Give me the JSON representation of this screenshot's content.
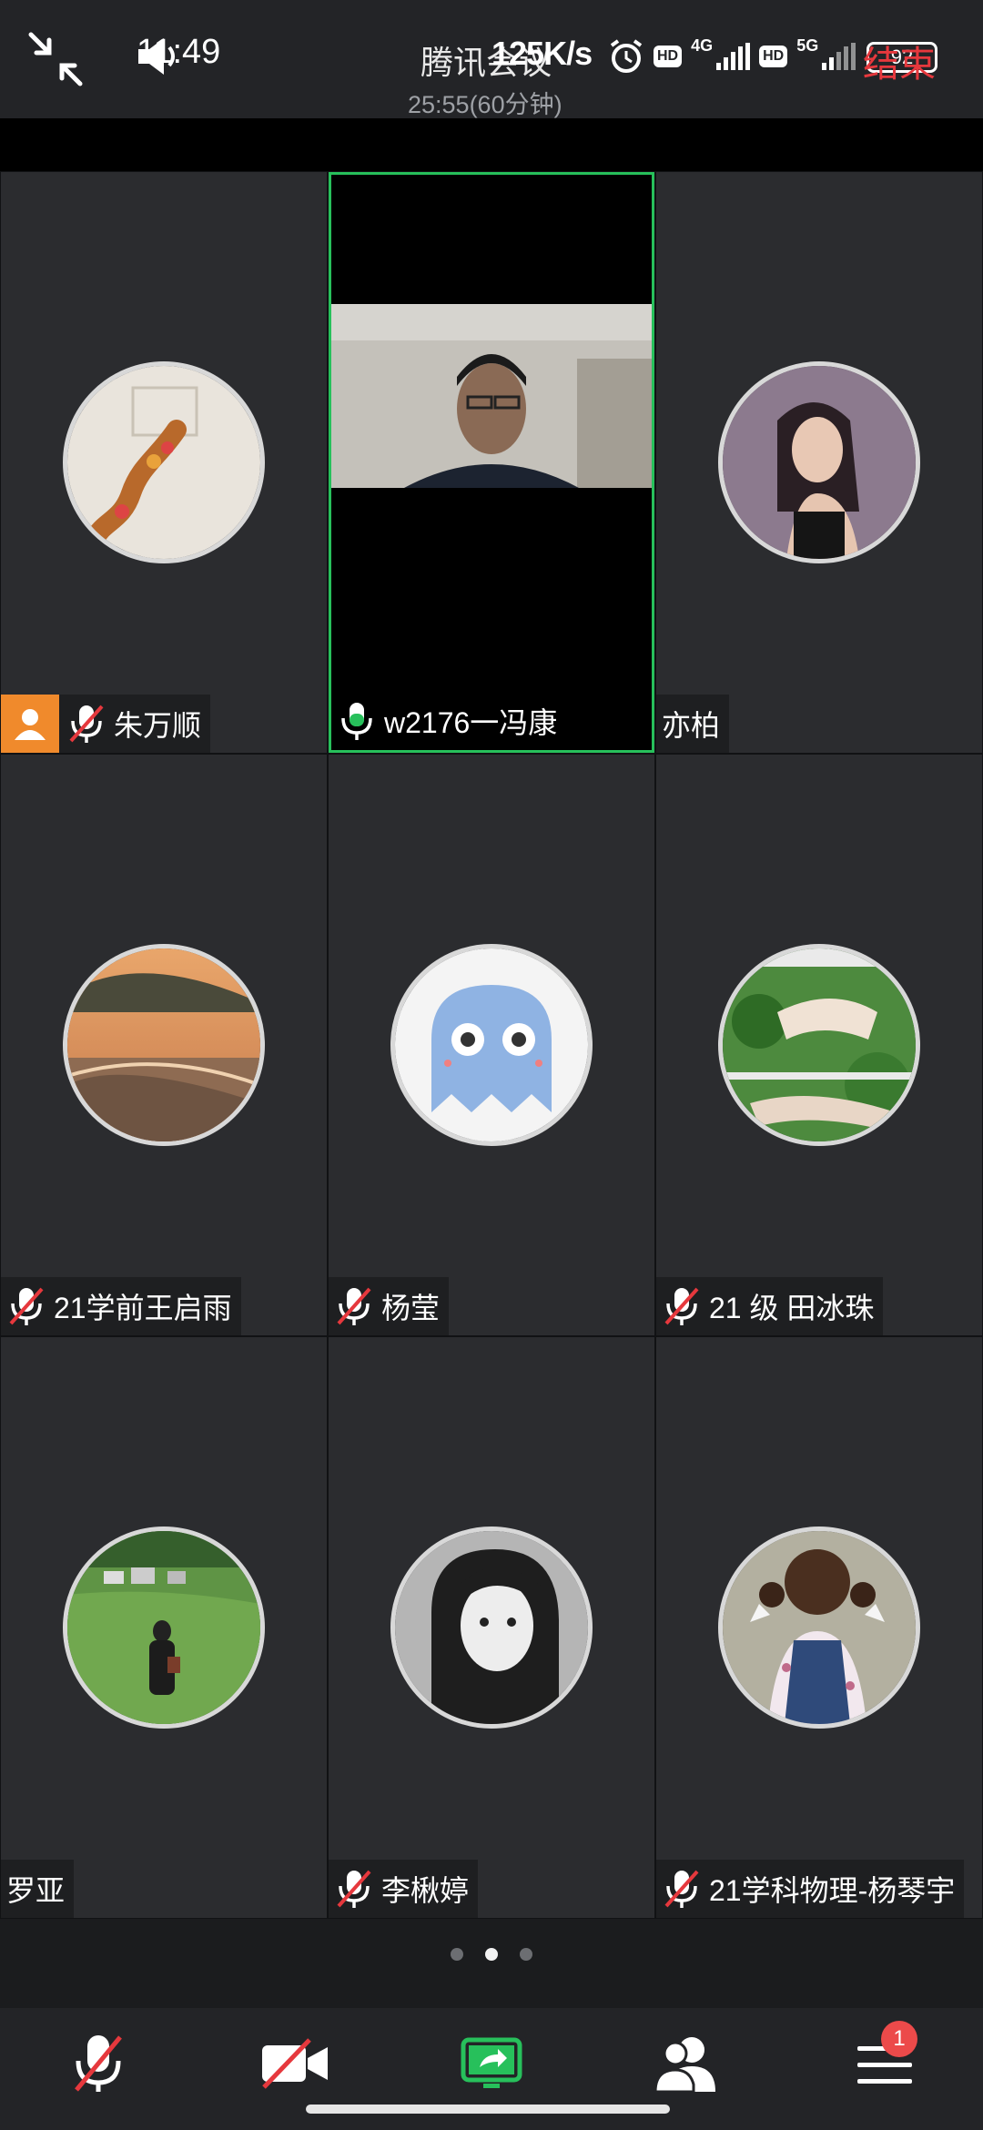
{
  "status_bar": {
    "time": "11:49",
    "net_speed": "125K/s",
    "battery": "92",
    "net_1": "4G",
    "net_2": "5G",
    "hd_label": "HD"
  },
  "meeting": {
    "title": "腾讯会议",
    "elapsed": "25:55(60分钟)",
    "end_label": "结束"
  },
  "participants": [
    {
      "name": "朱万顺",
      "muted": true,
      "host": true,
      "avatar": "basketball-flowers"
    },
    {
      "name": "w2176一冯康",
      "muted": false,
      "host": false,
      "avatar": "camera-video",
      "active_speaker": true
    },
    {
      "name": "亦柏",
      "muted": null,
      "host": false,
      "avatar": "woman-portrait"
    },
    {
      "name": "21学前王启雨",
      "muted": true,
      "host": false,
      "avatar": "sunset-beach"
    },
    {
      "name": "杨莹",
      "muted": true,
      "host": false,
      "avatar": "blue-ghost"
    },
    {
      "name": "21 级 田冰珠",
      "muted": true,
      "host": false,
      "avatar": "woman-in-grass"
    },
    {
      "name": "罗亚",
      "muted": null,
      "host": false,
      "avatar": "person-in-field"
    },
    {
      "name": "李楸婷",
      "muted": true,
      "host": false,
      "avatar": "girl-bw"
    },
    {
      "name": "21学科物理-杨琴宇",
      "muted": true,
      "host": false,
      "avatar": "child-with-bows"
    }
  ],
  "paging": {
    "pages": 3,
    "current": 2
  },
  "toolbar": {
    "items": [
      "mute-mic",
      "stop-video",
      "share-screen",
      "participants",
      "more"
    ],
    "more_badge": "1"
  },
  "colors": {
    "accent_green": "#27c05b",
    "end_red": "#e6383d",
    "host_orange": "#f08a2c",
    "badge_red": "#ec4a4a"
  }
}
